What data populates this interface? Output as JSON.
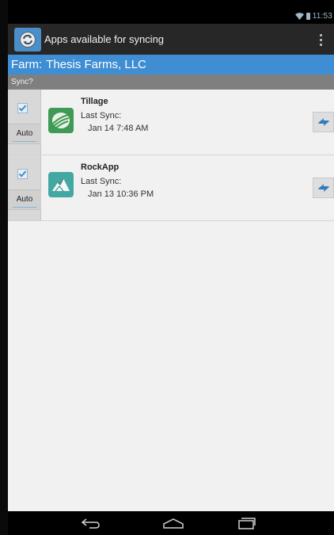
{
  "status": {
    "time": "11:53"
  },
  "action_bar": {
    "title": "Apps available for syncing",
    "icon": "sync-app-logo-icon",
    "menu_icon": "overflow-menu-icon"
  },
  "farm": {
    "label": "Farm:",
    "name": "Thesis Farms, LLC"
  },
  "list_header": {
    "sync_label": "Sync?"
  },
  "apps": [
    {
      "name": "Tillage",
      "last_sync_label": "Last Sync:",
      "last_sync_time": "Jan 14 7:48 AM",
      "checked": true,
      "mode": "Auto",
      "icon": "tillage-app-icon",
      "icon_color": "#3e9a55"
    },
    {
      "name": "RockApp",
      "last_sync_label": "Last Sync:",
      "last_sync_time": "Jan 13 10:36 PM",
      "checked": true,
      "mode": "Auto",
      "icon": "rockapp-app-icon",
      "icon_color": "#43a8a1"
    }
  ],
  "nav": {
    "back_icon": "back-icon",
    "home_icon": "home-icon",
    "recents_icon": "recent-apps-icon"
  },
  "colors": {
    "accent": "#3f8ed4",
    "action_bar": "#272727",
    "header": "#7f7f7f",
    "background": "#f1f1f1"
  }
}
